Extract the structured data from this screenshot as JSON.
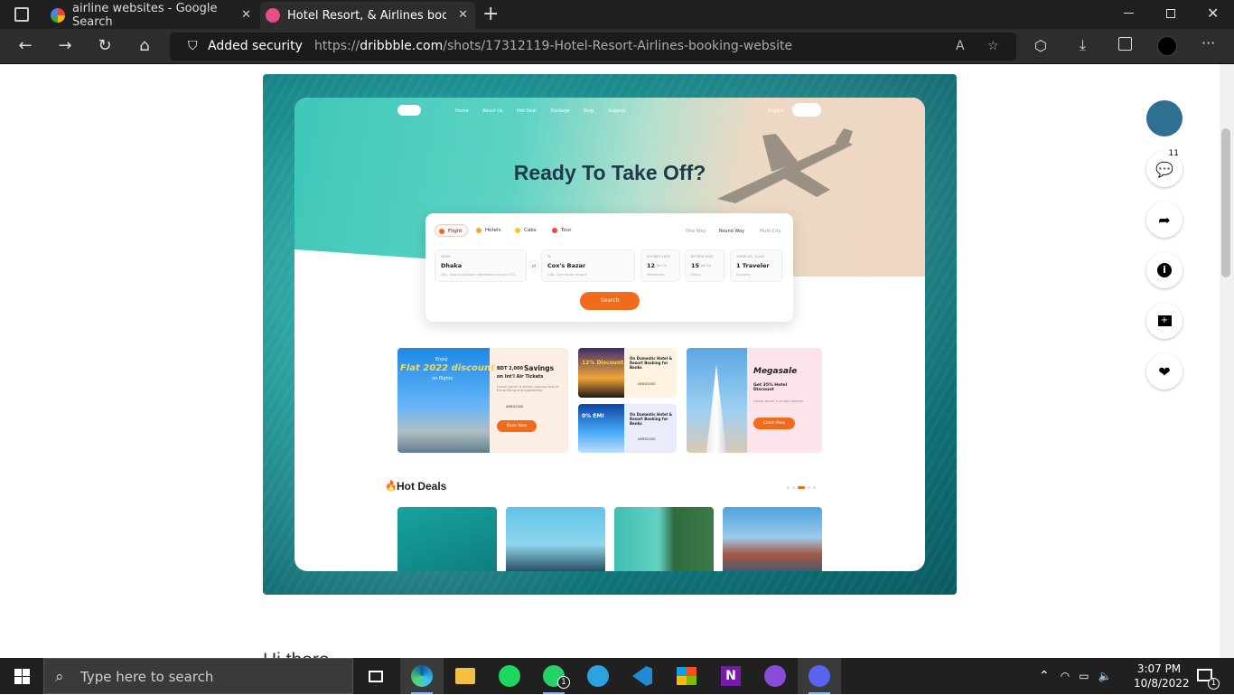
{
  "browser": {
    "tabs": [
      {
        "title": "airline websites - Google Search",
        "icon": "google-icon"
      },
      {
        "title": "Hotel Resort, & Airlines booking",
        "icon": "dribbble-icon"
      }
    ],
    "new_tab": "+",
    "security_label": "Added security",
    "url_prefix": "https://",
    "url_domain": "dribbble.com",
    "url_path": "/shots/17312119-Hotel-Resort-Airlines-booking-website"
  },
  "site": {
    "nav": [
      "Home",
      "About Us",
      "Hot Deal",
      "Package",
      "Blog",
      "Support"
    ],
    "language": "English",
    "hero_title": "Ready To Take Off?",
    "tabs": [
      "Flight",
      "Hotels",
      "Cabs",
      "Tour"
    ],
    "trip_types": [
      "One Way",
      "Round Way",
      "Multi City"
    ],
    "from": {
      "label": "FROM",
      "value": "Dhaka",
      "sub": "DAC, Hazrat Shahjalal International Airport TO..."
    },
    "to": {
      "label": "To",
      "value": "Cox's Bazar",
      "sub": "CXB, Cox's Bazar Airport"
    },
    "journey": {
      "label": "JOURNEY DATE",
      "value": "12",
      "month": "Jan'22",
      "sub": "Wednesday"
    },
    "ret": {
      "label": "RETURN DATE",
      "value": "15",
      "month": "Jan'22",
      "sub": "Friday"
    },
    "traveler": {
      "label": "TRAVELER, CLASS",
      "value": "1 Traveler",
      "sub": "Economy"
    },
    "search_btn": "Search",
    "promo1": {
      "enjoy": "Enjoy",
      "headline": "Flat 2022 discount",
      "on": "on flights",
      "bdt": "BDT 2,000",
      "savings": "Savings",
      "line2": "on Int'l Air Tickets",
      "desc": "Lorem Ipsum is simply dummy text of the printing and typesetting",
      "code": "AMEX2000",
      "btn": "Book Now"
    },
    "promo2": {
      "badge": "12% Discount",
      "line": "On Domestic Hotel & Resort Booking for Banks",
      "code": "AMEX2000"
    },
    "promo3": {
      "badge": "0% EMI",
      "line": "On Domestic Hotel & Resort Booking for Banks",
      "code": "AMEX2000"
    },
    "promo4": {
      "title": "Megasale",
      "sub": "Get 35% Hotel Discount",
      "desc": "Lorem Ipsum is simply dummy",
      "btn": "Claim Now"
    },
    "hot_deals": "Hot Deals"
  },
  "sidebar": {
    "comment_count": "11"
  },
  "below_text": "Hi there",
  "taskbar": {
    "search_placeholder": "Type here to search",
    "whatsapp_badge": "1",
    "time": "3:07 PM",
    "date": "10/8/2022",
    "notif_count": "1"
  },
  "colors": {
    "accent": "#f26a1b",
    "teal": "#3fc7b9",
    "browser_bg": "#202020"
  }
}
